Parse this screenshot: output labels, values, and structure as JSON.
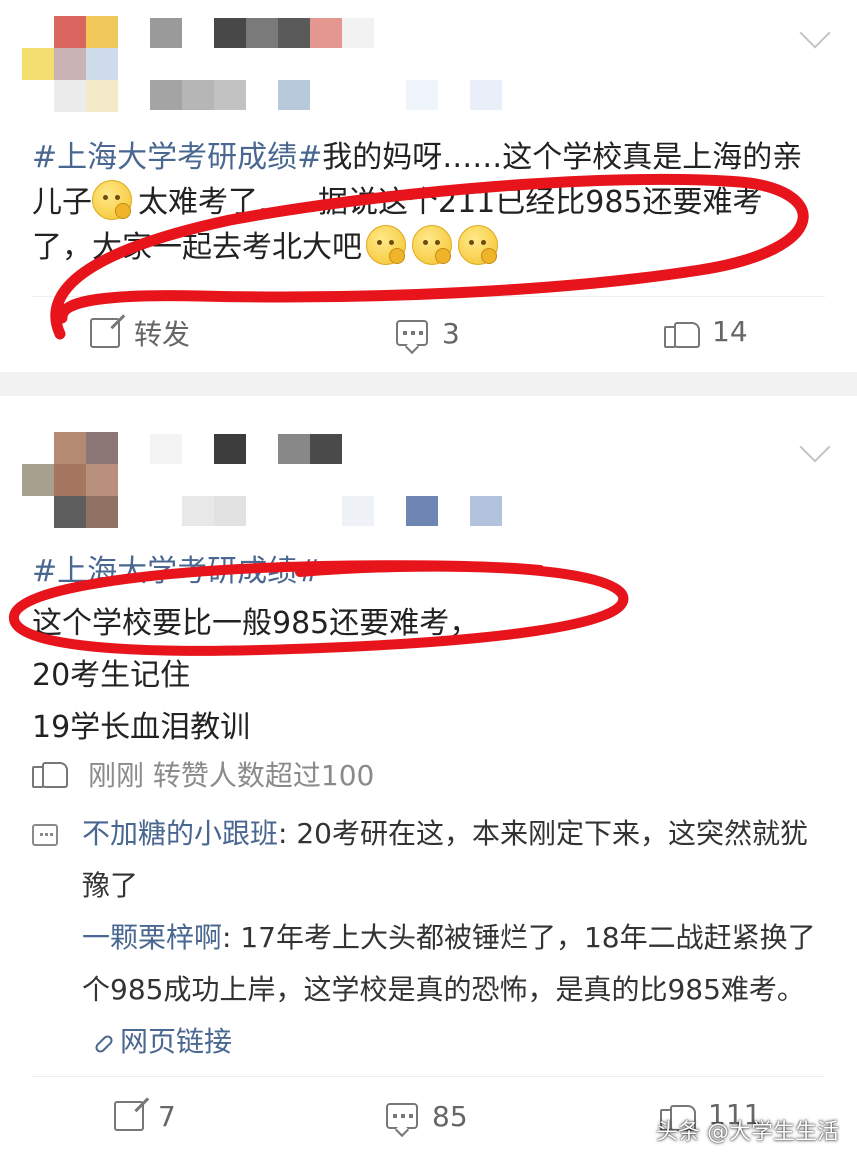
{
  "post1": {
    "topic": "#上海大学考研成绩#",
    "text_part1": "我的妈呀……这个学校真是上海的亲儿子",
    "text_part2": "太难考了……据说这个211已经比985还要难考了，大家一起去考北大吧",
    "actions": {
      "share_label": "转发",
      "comment_count": "3",
      "like_count": "14"
    }
  },
  "post2": {
    "topic": "#上海大学考研成绩#",
    "line1": "这个学校要比一般985还要难考，",
    "line2": "20考生记住",
    "line3": "19学长血泪教训",
    "likes_line": "刚刚 转赞人数超过100",
    "comments": [
      {
        "name": "不加糖的小跟班",
        "text": ": 20考研在这，本来刚定下来，这突然就犹豫了"
      },
      {
        "name": "一颗栗梓啊",
        "text": ": 17年考上大头都被锤烂了，18年二战赶紧换了个985成功上岸，这学校是真的恐怖，是真的比985难考。",
        "link": "网页链接"
      }
    ],
    "actions": {
      "share_count": "7",
      "comment_count": "85",
      "like_count": "111"
    }
  },
  "watermark": "头条 @大学生生活",
  "colors": {
    "topic": "#496790",
    "annotation": "#e8141b",
    "background": "#f2f2f2"
  },
  "icons": [
    "chevron-down-icon",
    "share-icon",
    "comment-icon",
    "like-icon",
    "link-icon",
    "emoji-icon"
  ]
}
